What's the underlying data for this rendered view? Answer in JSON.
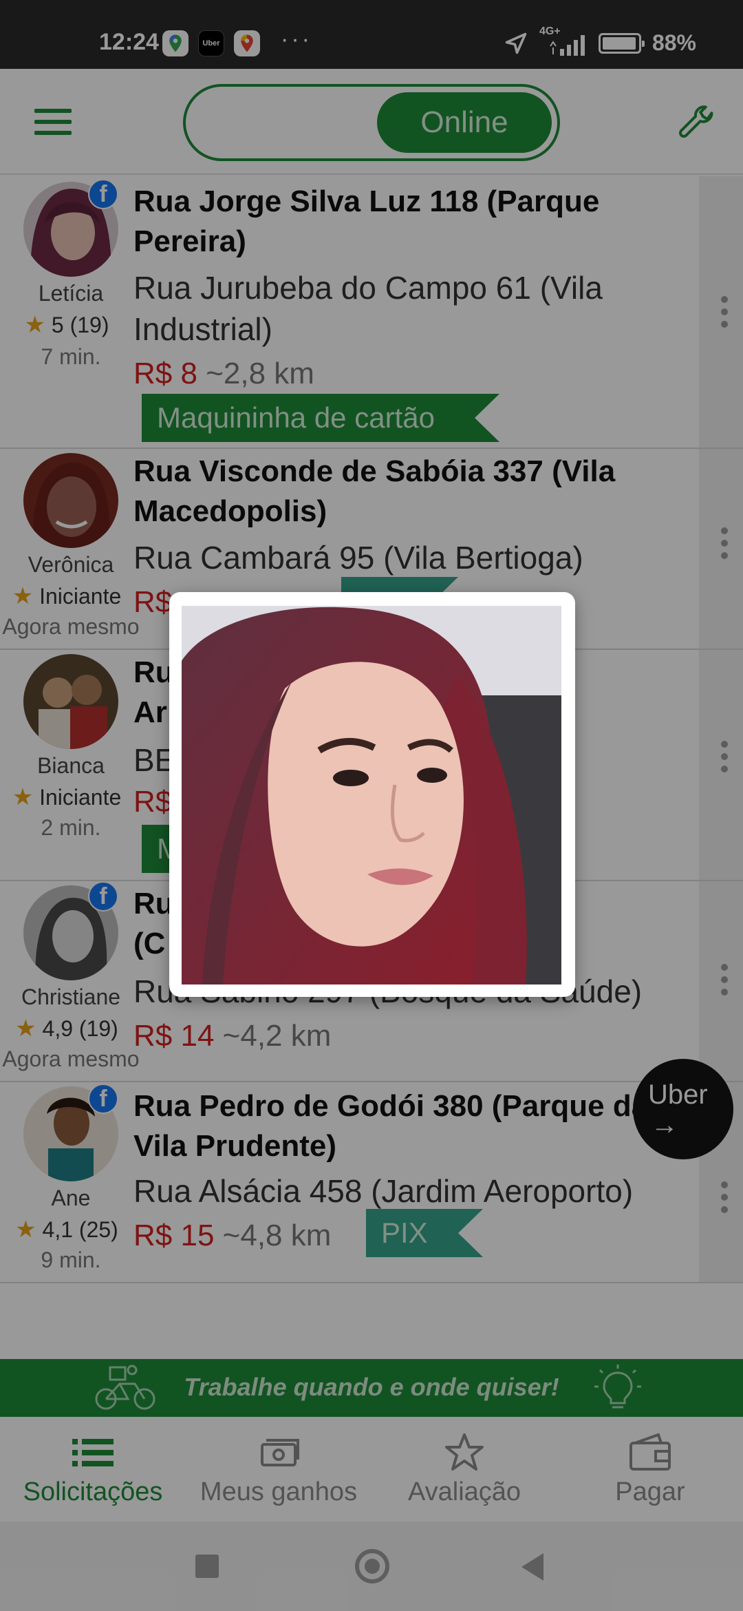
{
  "status_bar": {
    "time": "12:24",
    "network": "4G+",
    "battery": "88%",
    "battery_level": 0.88,
    "overflow": "···"
  },
  "app_bar": {
    "toggle_label": "Online",
    "menu_icon": "hamburger-icon",
    "settings_icon": "wrench-icon"
  },
  "requests": [
    {
      "name": "Letícia",
      "rating": "5 (19)",
      "time": "7 min.",
      "from": "Rua Jorge Silva Luz 118 (Parque Pereira)",
      "to": "Rua Jurubeba do Campo 61 (Vila Industrial)",
      "price": "R$ 8",
      "distance": "~2,8 km",
      "tag": "Maquininha de cartão",
      "facebook": true
    },
    {
      "name": "Verônica",
      "rating": "Iniciante",
      "time": "Agora mesmo",
      "from": "Rua Visconde de Sabóia 337 (Vila Macedopolis)",
      "to": "Rua Cambará 95 (Vila Bertioga)",
      "price": "R$",
      "distance": "",
      "tag": "",
      "facebook": false
    },
    {
      "name": "Bianca",
      "rating": "Iniciante",
      "time": "2 min.",
      "from": "Ru                          dim",
      "from_line2": "Ar",
      "to": "BE                            li)",
      "price": "R$",
      "distance": "",
      "tag": "M",
      "facebook": false
    },
    {
      "name": "Christiane",
      "rating": "4,9 (19)",
      "time": "Agora mesmo",
      "from": "Ru                            4",
      "from_line2": "(C",
      "to": "Rua Sabinó 297 (Bosque da Saúde)",
      "price": "R$ 14",
      "distance": "~4,2 km",
      "tag": "",
      "facebook": true
    },
    {
      "name": "Ane",
      "rating": "4,1 (25)",
      "time": "9 min.",
      "from": "Rua Pedro de Godói 380 (Parque da Vila Prudente)",
      "to": "Rua Alsácia 458 (Jardim Aeroporto)",
      "price": "R$ 15",
      "distance": "~4,8 km",
      "tag": "PIX",
      "facebook": true
    }
  ],
  "dialog": {
    "image": "profile-photo-enlarged"
  },
  "uber_fab": {
    "label": "Uber",
    "arrow": "→"
  },
  "banner": {
    "text": "Trabalhe quando e onde quiser!"
  },
  "bottom_nav": [
    {
      "label": "Solicitações",
      "icon": "list-icon",
      "active": true
    },
    {
      "label": "Meus ganhos",
      "icon": "money-icon",
      "active": false
    },
    {
      "label": "Avaliação",
      "icon": "star-icon",
      "active": false
    },
    {
      "label": "Pagar",
      "icon": "wallet-icon",
      "active": false
    }
  ],
  "colors": {
    "primary": "#1e8a3a",
    "price": "#d32020",
    "pix": "#36a38c",
    "facebook": "#1877f2"
  }
}
